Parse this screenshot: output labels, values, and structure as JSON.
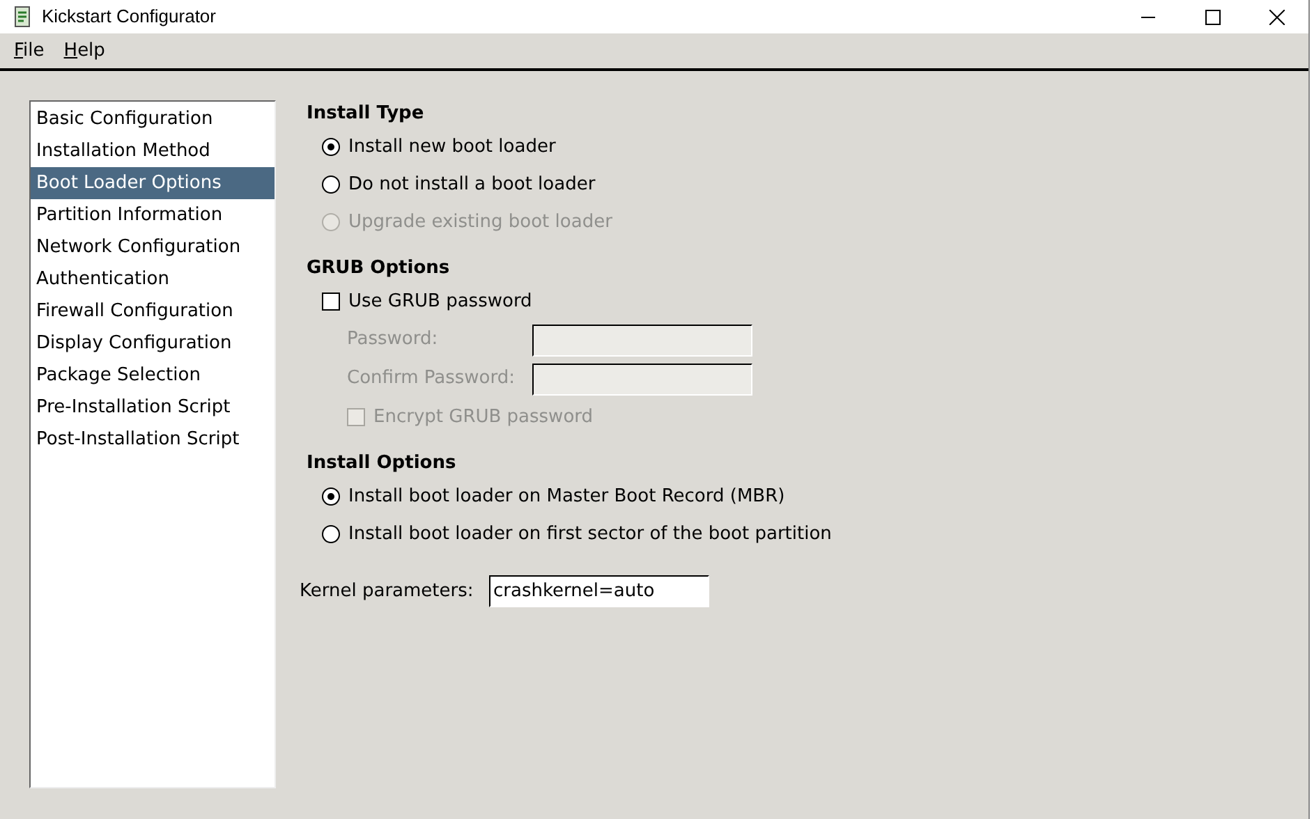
{
  "window": {
    "title": "Kickstart Configurator"
  },
  "menu": [
    {
      "label": "File"
    },
    {
      "label": "Help"
    }
  ],
  "sidebar": {
    "items": [
      {
        "label": "Basic Configuration",
        "selected": false
      },
      {
        "label": "Installation Method",
        "selected": false
      },
      {
        "label": "Boot Loader Options",
        "selected": true
      },
      {
        "label": "Partition Information",
        "selected": false
      },
      {
        "label": "Network Configuration",
        "selected": false
      },
      {
        "label": "Authentication",
        "selected": false
      },
      {
        "label": "Firewall Configuration",
        "selected": false
      },
      {
        "label": "Display Configuration",
        "selected": false
      },
      {
        "label": "Package Selection",
        "selected": false
      },
      {
        "label": "Pre-Installation Script",
        "selected": false
      },
      {
        "label": "Post-Installation Script",
        "selected": false
      }
    ]
  },
  "sections": [
    {
      "title": "Install Type",
      "items": [
        {
          "kind": "radio",
          "label": "Install new boot loader",
          "selected": true,
          "disabled": false
        },
        {
          "kind": "radio",
          "label": "Do not install a boot loader",
          "selected": false,
          "disabled": false
        },
        {
          "kind": "radio",
          "label": "Upgrade existing boot loader",
          "selected": false,
          "disabled": true
        }
      ]
    },
    {
      "title": "GRUB Options",
      "items": [
        {
          "kind": "checkbox",
          "label": "Use GRUB password",
          "checked": false,
          "disabled": false
        },
        {
          "kind": "field",
          "label": "Password:",
          "disabled": true
        },
        {
          "kind": "field",
          "label": "Confirm Password:",
          "disabled": true
        },
        {
          "kind": "checkbox",
          "label": "Encrypt GRUB password",
          "checked": false,
          "disabled": true
        }
      ]
    },
    {
      "title": "Install Options",
      "items": [
        {
          "kind": "radio",
          "label": "Install boot loader on Master Boot Record (MBR)",
          "selected": true,
          "disabled": false
        },
        {
          "kind": "radio",
          "label": "Install boot loader on first sector of the boot partition",
          "selected": false,
          "disabled": false
        }
      ]
    }
  ],
  "kernel": {
    "label": "Kernel parameters:",
    "value": "crashkernel=auto"
  }
}
